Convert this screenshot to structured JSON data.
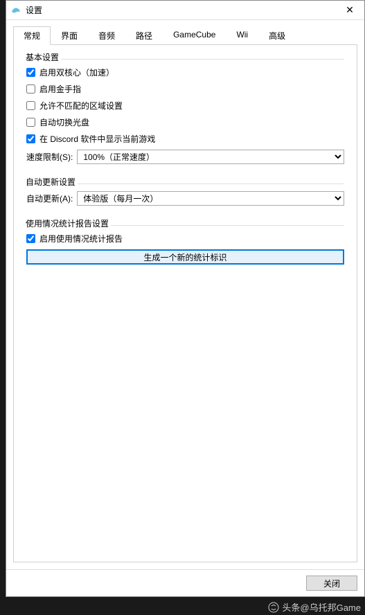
{
  "window": {
    "title": "设置"
  },
  "tabs": [
    {
      "label": "常规",
      "active": true
    },
    {
      "label": "界面",
      "active": false
    },
    {
      "label": "音频",
      "active": false
    },
    {
      "label": "路径",
      "active": false
    },
    {
      "label": "GameCube",
      "active": false
    },
    {
      "label": "Wii",
      "active": false
    },
    {
      "label": "高级",
      "active": false
    }
  ],
  "groups": {
    "basic": {
      "title": "基本设置",
      "dualCore": {
        "label": "启用双核心（加速）",
        "checked": true
      },
      "cheats": {
        "label": "启用金手指",
        "checked": false
      },
      "regionMismatch": {
        "label": "允许不匹配的区域设置",
        "checked": false
      },
      "autoDisc": {
        "label": "自动切换光盘",
        "checked": false
      },
      "discord": {
        "label": "在 Discord 软件中显示当前游戏",
        "checked": true
      },
      "speedLimit": {
        "label": "速度限制(S):",
        "value": "100%（正常速度）"
      }
    },
    "autoUpdate": {
      "title": "自动更新设置",
      "autoUpdate": {
        "label": "自动更新(A):",
        "value": "体验版（每月一次）"
      }
    },
    "usageStats": {
      "title": "使用情况统计报告设置",
      "enable": {
        "label": "启用使用情况统计报告",
        "checked": true
      },
      "newIdButton": "生成一个新的统计标识"
    }
  },
  "footer": {
    "close": "关闭"
  },
  "watermark": {
    "text": "头条@乌托邦Game"
  }
}
